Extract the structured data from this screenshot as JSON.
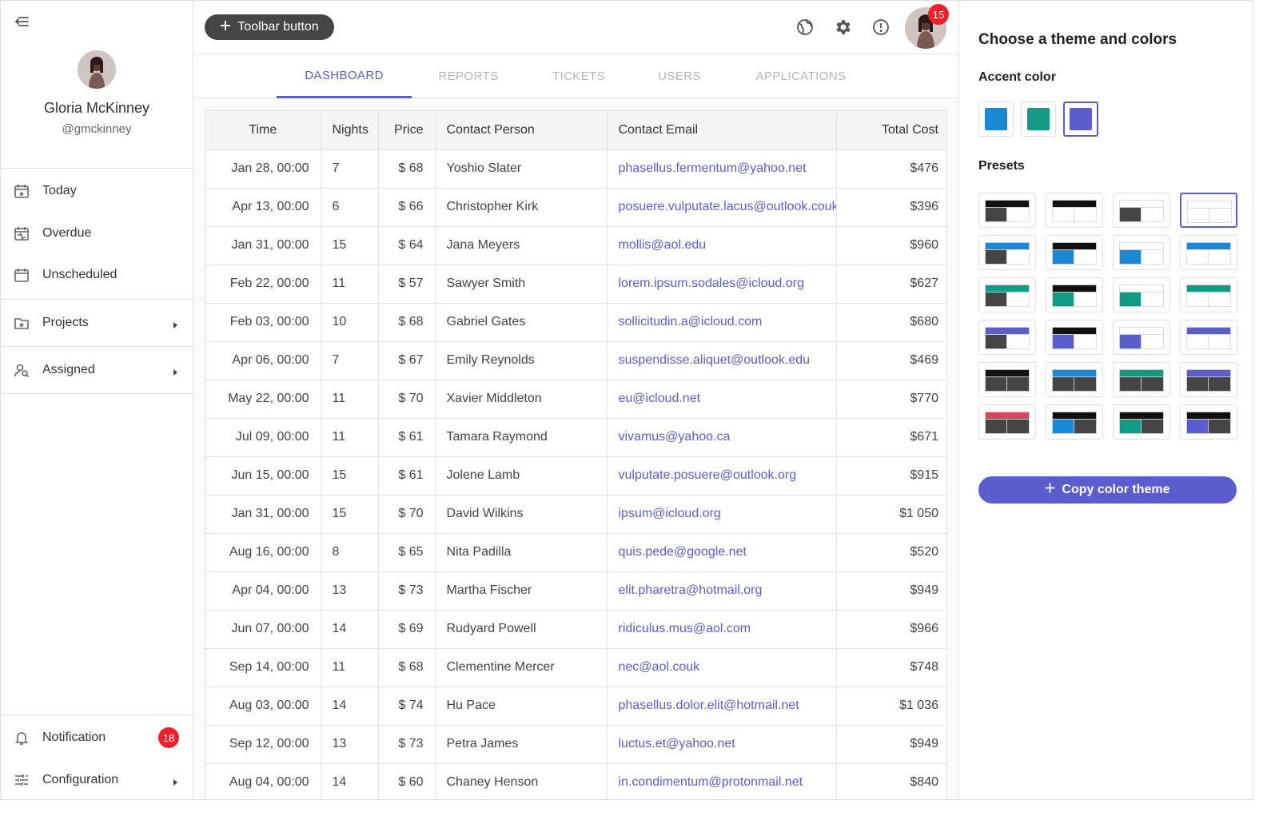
{
  "sidebar": {
    "profile": {
      "name": "Gloria McKinney",
      "handle": "@gmckinney"
    },
    "nav_items": [
      {
        "label": "Today"
      },
      {
        "label": "Overdue"
      },
      {
        "label": "Unscheduled"
      },
      {
        "label": "Projects"
      },
      {
        "label": "Assigned"
      }
    ],
    "bottom_items": [
      {
        "label": "Notification",
        "badge": "18"
      },
      {
        "label": "Configuration"
      }
    ]
  },
  "toolbar": {
    "button_label": "Toolbar button",
    "avatar_badge": "15"
  },
  "tabs": [
    {
      "label": "DASHBOARD"
    },
    {
      "label": "REPORTS"
    },
    {
      "label": "TICKETS"
    },
    {
      "label": "USERS"
    },
    {
      "label": "APPLICATIONS"
    }
  ],
  "table": {
    "columns": [
      "Time",
      "Nights",
      "Price",
      "Contact Person",
      "Contact Email",
      "Total Cost"
    ],
    "rows": [
      [
        "Jan 28, 00:00",
        "7",
        "$ 68",
        "Yoshio Slater",
        "phasellus.fermentum@yahoo.net",
        "$476"
      ],
      [
        "Apr 13, 00:00",
        "6",
        "$ 66",
        "Christopher Kirk",
        "posuere.vulputate.lacus@outlook.couk",
        "$396"
      ],
      [
        "Jan 31, 00:00",
        "15",
        "$ 64",
        "Jana Meyers",
        "mollis@aol.edu",
        "$960"
      ],
      [
        "Feb 22, 00:00",
        "11",
        "$ 57",
        "Sawyer Smith",
        "lorem.ipsum.sodales@icloud.org",
        "$627"
      ],
      [
        "Feb 03, 00:00",
        "10",
        "$ 68",
        "Gabriel Gates",
        "sollicitudin.a@icloud.com",
        "$680"
      ],
      [
        "Apr 06, 00:00",
        "7",
        "$ 67",
        "Emily Reynolds",
        "suspendisse.aliquet@outlook.edu",
        "$469"
      ],
      [
        "May 22, 00:00",
        "11",
        "$ 70",
        "Xavier Middleton",
        "eu@icloud.net",
        "$770"
      ],
      [
        "Jul 09, 00:00",
        "11",
        "$ 61",
        "Tamara Raymond",
        "vivamus@yahoo.ca",
        "$671"
      ],
      [
        "Jun 15, 00:00",
        "15",
        "$ 61",
        "Jolene Lamb",
        "vulputate.posuere@outlook.org",
        "$915"
      ],
      [
        "Jan 31, 00:00",
        "15",
        "$ 70",
        "David Wilkins",
        "ipsum@icloud.org",
        "$1 050"
      ],
      [
        "Aug 16, 00:00",
        "8",
        "$ 65",
        "Nita Padilla",
        "quis.pede@google.net",
        "$520"
      ],
      [
        "Apr 04, 00:00",
        "13",
        "$ 73",
        "Martha Fischer",
        "elit.pharetra@hotmail.org",
        "$949"
      ],
      [
        "Jun 07, 00:00",
        "14",
        "$ 69",
        "Rudyard Powell",
        "ridiculus.mus@aol.com",
        "$966"
      ],
      [
        "Sep 14, 00:00",
        "11",
        "$ 68",
        "Clementine Mercer",
        "nec@aol.couk",
        "$748"
      ],
      [
        "Aug 03, 00:00",
        "14",
        "$ 74",
        "Hu Pace",
        "phasellus.dolor.elit@hotmail.net",
        "$1 036"
      ],
      [
        "Sep 12, 00:00",
        "13",
        "$ 73",
        "Petra James",
        "luctus.et@yahoo.net",
        "$949"
      ],
      [
        "Aug 04, 00:00",
        "14",
        "$ 60",
        "Chaney Henson",
        "in.condimentum@protonmail.net",
        "$840"
      ]
    ]
  },
  "theme_panel": {
    "title": "Choose a theme and colors",
    "accent_label": "Accent color",
    "accent_colors": [
      "#1a88d4",
      "#129a84",
      "#5a5ecd"
    ],
    "selected_accent": 2,
    "presets_label": "Presets",
    "copy_button": "Copy color theme",
    "colors": {
      "dark": "#111111",
      "gray": "#454545",
      "blue": "#1a88d4",
      "teal": "#129a84",
      "purple": "#5a5ecd",
      "red": "#d6455f"
    }
  }
}
